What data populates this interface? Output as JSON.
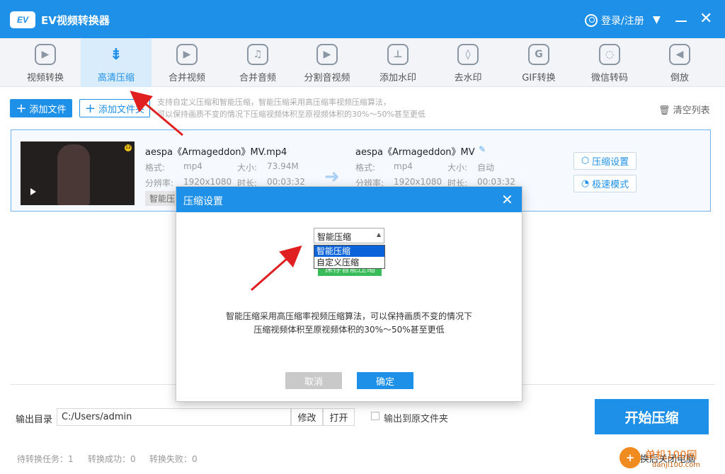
{
  "window": {
    "logo_text": "EV",
    "title": "EV视频转换器",
    "login": "登录/注册"
  },
  "toolbar": [
    {
      "label": "视频转换",
      "icon": "video-convert-icon"
    },
    {
      "label": "高清压缩",
      "icon": "compress-icon",
      "active": true
    },
    {
      "label": "合并视频",
      "icon": "merge-video-icon"
    },
    {
      "label": "合并音频",
      "icon": "merge-audio-icon"
    },
    {
      "label": "分割音视频",
      "icon": "split-icon"
    },
    {
      "label": "添加水印",
      "icon": "watermark-icon"
    },
    {
      "label": "去水印",
      "icon": "remove-watermark-icon"
    },
    {
      "label": "GIF转换",
      "icon": "gif-icon"
    },
    {
      "label": "微信转码",
      "icon": "wechat-icon"
    },
    {
      "label": "倒放",
      "icon": "reverse-icon"
    }
  ],
  "actions": {
    "add_file": "添加文件",
    "add_folder": "添加文件夹",
    "hint_line1": "支持自定义压缩和智能压缩，智能压缩采用高压缩率视频压缩算法，",
    "hint_line2": "可以保持画质不变的情况下压缩视频体积至原视频体积的30%～50%甚至更低",
    "clear": "清空列表"
  },
  "file": {
    "name": "aespa《Armageddon》MV.mp4",
    "format_label": "格式:",
    "format": "mp4",
    "size_label": "大小:",
    "size": "73.94M",
    "res_label": "分辨率:",
    "resolution": "1920x1080",
    "dur_label": "时长:",
    "duration": "00:03:32",
    "mode_chip": "智能压",
    "out_name": "aespa《Armageddon》MV",
    "out_format": "mp4",
    "out_size": "自动",
    "out_resolution": "1920x1080",
    "out_duration": "00:03:32",
    "settings_btn": "压缩设置",
    "fast_btn": "极速模式"
  },
  "bottom": {
    "out_label": "输出目录",
    "out_path": "C:/Users/admin",
    "modify": "修改",
    "open": "打开",
    "to_source": "输出到原文件夹",
    "start": "开始压缩",
    "pending": "待转换任务：1",
    "success": "转换成功：0",
    "failed": "转换失败：0",
    "close_after": "转换后关闭电脑"
  },
  "watermark": {
    "brand": "单机100网",
    "domain": "danji100.com"
  },
  "dialog": {
    "title": "压缩设置",
    "selected": "智能压缩",
    "options": [
      "智能压缩",
      "自定义压缩"
    ],
    "green_btn": "保存智能压缩",
    "desc_line1": "智能压缩采用高压缩率视频压缩算法，可以保持画质不变的情况下",
    "desc_line2": "压缩视频体积至原视频体积的30%～50%甚至更低",
    "cancel": "取消",
    "ok": "确定"
  },
  "colors": {
    "primary": "#1e90e8",
    "annotation": "#e02020"
  }
}
